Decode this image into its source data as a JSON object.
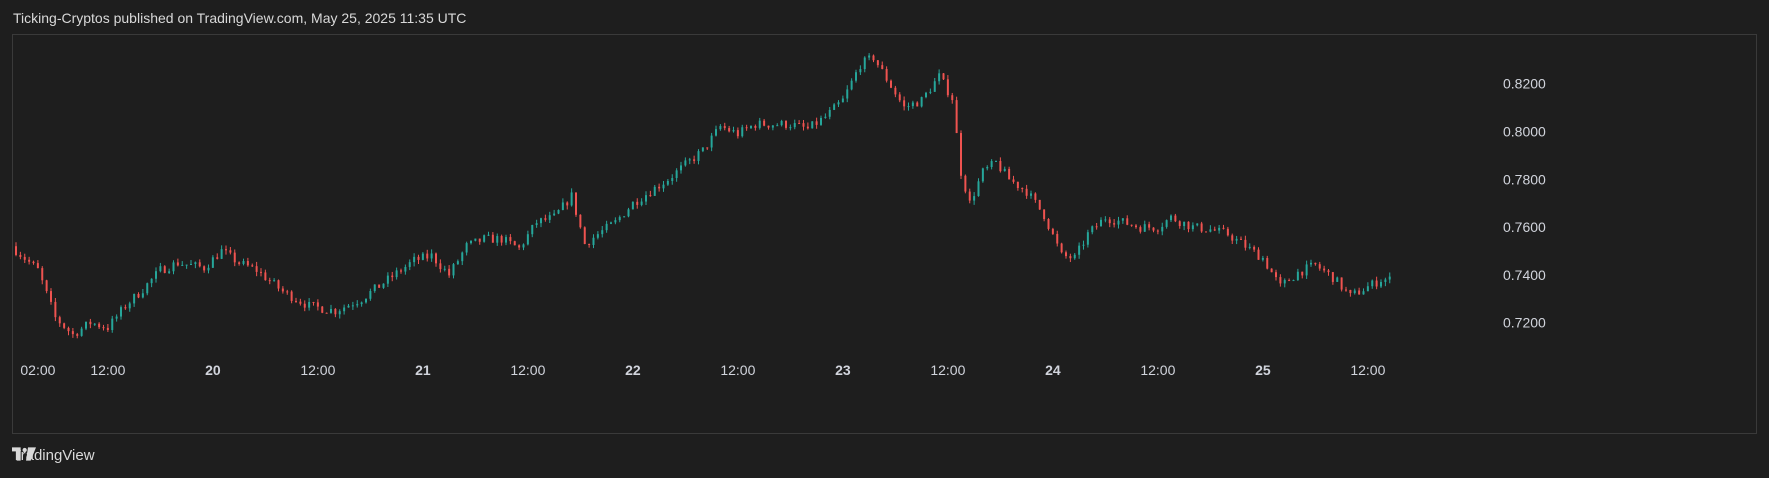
{
  "header": {
    "text": "Ticking-Cryptos published on TradingView.com, May 25, 2025 11:35 UTC"
  },
  "footer": {
    "brand": "TradingView"
  },
  "colors": {
    "up": "#26a69a",
    "down": "#ef5350",
    "background": "#1e1e1e",
    "axis_text": "#d1d4dc"
  },
  "chart_data": {
    "type": "candlestick",
    "ylim": [
      0.709,
      0.8395
    ],
    "y_ticks": [
      "0.7200",
      "0.7400",
      "0.7600",
      "0.7800",
      "0.8000",
      "0.8200"
    ],
    "y_tick_values": [
      0.72,
      0.74,
      0.76,
      0.78,
      0.8,
      0.82
    ],
    "x_range_hours": [
      0,
      168
    ],
    "x_ticks": [
      {
        "label": "02:00",
        "h": 0.5,
        "bold": false
      },
      {
        "label": "12:00",
        "h": 10.5,
        "bold": false
      },
      {
        "label": "20",
        "h": 22.5,
        "bold": true
      },
      {
        "label": "12:00",
        "h": 34.5,
        "bold": false
      },
      {
        "label": "21",
        "h": 46.5,
        "bold": true
      },
      {
        "label": "12:00",
        "h": 58.5,
        "bold": false
      },
      {
        "label": "22",
        "h": 70.5,
        "bold": true
      },
      {
        "label": "12:00",
        "h": 82.5,
        "bold": false
      },
      {
        "label": "23",
        "h": 94.5,
        "bold": true
      },
      {
        "label": "12:00",
        "h": 106.5,
        "bold": false
      },
      {
        "label": "24",
        "h": 118.5,
        "bold": true
      },
      {
        "label": "12:00",
        "h": 130.5,
        "bold": false
      },
      {
        "label": "25",
        "h": 142.5,
        "bold": true
      },
      {
        "label": "12:00",
        "h": 154.5,
        "bold": false
      }
    ],
    "close_path": [
      [
        0,
        0.752
      ],
      [
        3,
        0.742
      ],
      [
        5,
        0.722
      ],
      [
        7,
        0.715
      ],
      [
        9,
        0.72
      ],
      [
        11,
        0.718
      ],
      [
        13,
        0.727
      ],
      [
        15,
        0.734
      ],
      [
        17,
        0.742
      ],
      [
        19,
        0.745
      ],
      [
        22,
        0.743
      ],
      [
        24,
        0.75
      ],
      [
        26,
        0.745
      ],
      [
        28,
        0.742
      ],
      [
        31,
        0.733
      ],
      [
        34,
        0.727
      ],
      [
        37,
        0.725
      ],
      [
        40,
        0.73
      ],
      [
        43,
        0.738
      ],
      [
        46,
        0.746
      ],
      [
        48,
        0.748
      ],
      [
        50,
        0.74
      ],
      [
        52,
        0.752
      ],
      [
        54,
        0.755
      ],
      [
        56,
        0.755
      ],
      [
        58,
        0.751
      ],
      [
        60,
        0.762
      ],
      [
        62,
        0.764
      ],
      [
        64,
        0.773
      ],
      [
        65.5,
        0.753
      ],
      [
        67,
        0.757
      ],
      [
        69,
        0.762
      ],
      [
        71,
        0.77
      ],
      [
        73,
        0.775
      ],
      [
        75,
        0.78
      ],
      [
        77,
        0.786
      ],
      [
        79,
        0.792
      ],
      [
        81,
        0.802
      ],
      [
        83,
        0.799
      ],
      [
        85,
        0.803
      ],
      [
        87,
        0.803
      ],
      [
        89,
        0.803
      ],
      [
        91,
        0.801
      ],
      [
        93,
        0.806
      ],
      [
        95,
        0.813
      ],
      [
        97,
        0.828
      ],
      [
        98.5,
        0.831
      ],
      [
        100,
        0.822
      ],
      [
        102,
        0.81
      ],
      [
        104,
        0.813
      ],
      [
        106,
        0.823
      ],
      [
        107.5,
        0.814
      ],
      [
        108.5,
        0.783
      ],
      [
        109.5,
        0.77
      ],
      [
        111,
        0.783
      ],
      [
        112.5,
        0.787
      ],
      [
        114,
        0.78
      ],
      [
        116,
        0.775
      ],
      [
        118,
        0.765
      ],
      [
        120,
        0.748
      ],
      [
        121.5,
        0.747
      ],
      [
        123,
        0.757
      ],
      [
        125,
        0.764
      ],
      [
        127,
        0.762
      ],
      [
        129,
        0.76
      ],
      [
        131,
        0.76
      ],
      [
        132.5,
        0.764
      ],
      [
        135,
        0.76
      ],
      [
        137,
        0.759
      ],
      [
        139,
        0.757
      ],
      [
        141,
        0.752
      ],
      [
        143,
        0.747
      ],
      [
        145,
        0.735
      ],
      [
        147,
        0.741
      ],
      [
        149,
        0.744
      ],
      [
        151,
        0.739
      ],
      [
        153,
        0.731
      ],
      [
        155,
        0.735
      ],
      [
        156.5,
        0.738
      ]
    ]
  }
}
